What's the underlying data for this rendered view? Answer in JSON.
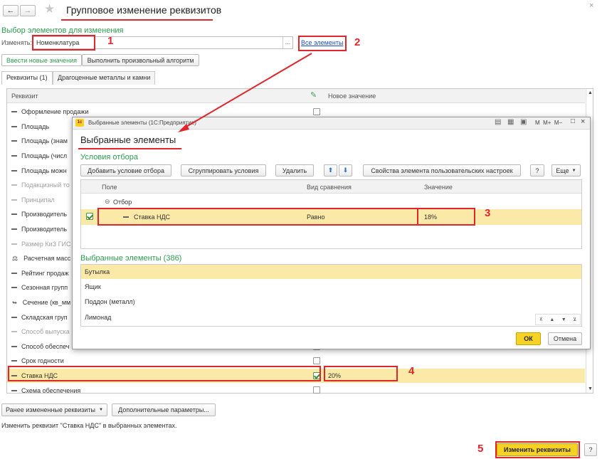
{
  "window": {
    "title": "Групповое изменение реквизитов",
    "back_icon": "arrow-left",
    "forward_icon": "arrow-right",
    "star_icon": "star"
  },
  "selection": {
    "heading": "Выбор элементов для изменения",
    "change_label": "Изменять:",
    "change_value": "Номенклатура",
    "ellipsis": "...",
    "all_elements_link": "Все элементы"
  },
  "mode_tabs": [
    "Ввести новые значения",
    "Выполнить произвольный алгоритм"
  ],
  "main_tabs": [
    "Реквизиты (1)",
    "Драгоценные металлы и камни"
  ],
  "table": {
    "col_requisite": "Реквизит",
    "col_new_value": "Новое значение",
    "rows": [
      {
        "label": "Оформление продажи",
        "disabled": false,
        "checked": false,
        "value": ""
      },
      {
        "label": "Площадь",
        "disabled": false,
        "checked": false,
        "value": ""
      },
      {
        "label": "Площадь (знам",
        "disabled": false,
        "checked": false,
        "value": ""
      },
      {
        "label": "Площадь (числ",
        "disabled": false,
        "checked": false,
        "value": ""
      },
      {
        "label": "Площадь можн",
        "disabled": false,
        "checked": false,
        "value": ""
      },
      {
        "label": "Подакцизный то",
        "disabled": true,
        "checked": false,
        "value": ""
      },
      {
        "label": "Принципал",
        "disabled": true,
        "checked": false,
        "value": ""
      },
      {
        "label": "Производитель",
        "disabled": false,
        "checked": false,
        "value": ""
      },
      {
        "label": "Производитель",
        "disabled": false,
        "checked": false,
        "value": ""
      },
      {
        "label": "Размер КиЗ ГИС",
        "disabled": true,
        "checked": false,
        "value": ""
      },
      {
        "label": "Расчетная масс",
        "disabled": false,
        "checked": false,
        "value": ""
      },
      {
        "label": "Рейтинг продаж",
        "disabled": false,
        "checked": false,
        "value": ""
      },
      {
        "label": "Сезонная групп",
        "disabled": false,
        "checked": false,
        "value": ""
      },
      {
        "label": "Сечение (кв_мм",
        "disabled": false,
        "checked": false,
        "value": ""
      },
      {
        "label": "Складская груп",
        "disabled": false,
        "checked": false,
        "value": ""
      },
      {
        "label": "Способ выпуска",
        "disabled": true,
        "checked": false,
        "value": ""
      },
      {
        "label": "Способ обеспеч",
        "disabled": false,
        "checked": false,
        "value": ""
      },
      {
        "label": "Срок годности",
        "disabled": false,
        "checked": false,
        "value": ""
      },
      {
        "label": "Ставка НДС",
        "disabled": false,
        "checked": true,
        "value": "20%"
      },
      {
        "label": "Схема обеспечения",
        "disabled": false,
        "checked": false,
        "value": ""
      }
    ]
  },
  "bottom": {
    "prev_changed": "Ранее измененные реквизиты",
    "extra_params": "Дополнительные параметры...",
    "status_text": "Изменить реквизит \"Ставка НДС\" в выбранных элементах.",
    "apply_button": "Изменить реквизиты",
    "help": "?"
  },
  "dialog": {
    "window_title": "Выбранные элементы  (1С:Предприятие)",
    "tb_icons": "M  M+  M−",
    "heading": "Выбранные элементы",
    "filter_heading": "Условия отбора",
    "toolbar": {
      "add_condition": "Добавить условие отбора",
      "group_conditions": "Сгруппировать условия",
      "delete": "Удалить",
      "props": "Свойства элемента пользовательских настроек",
      "help": "?",
      "more": "Еще"
    },
    "filter_cols": [
      "Поле",
      "Вид сравнения",
      "Значение"
    ],
    "filter_group": "Отбор",
    "filter_row": {
      "field": "Ставка НДС",
      "comparison": "Равно",
      "value": "18%"
    },
    "list_heading": "Выбранные элементы (386)",
    "items": [
      "Бутылка",
      "Ящик",
      "Поддон (металл)",
      "Лимонад"
    ],
    "ok": "ОК",
    "cancel": "Отмена"
  },
  "annotations": [
    "1",
    "2",
    "3",
    "4",
    "5"
  ],
  "colors": {
    "accent_green": "#2e9a52",
    "annotation_red": "#e0262c",
    "highlight_yellow": "#fbe9a8",
    "ok_yellow": "#f5d223"
  }
}
